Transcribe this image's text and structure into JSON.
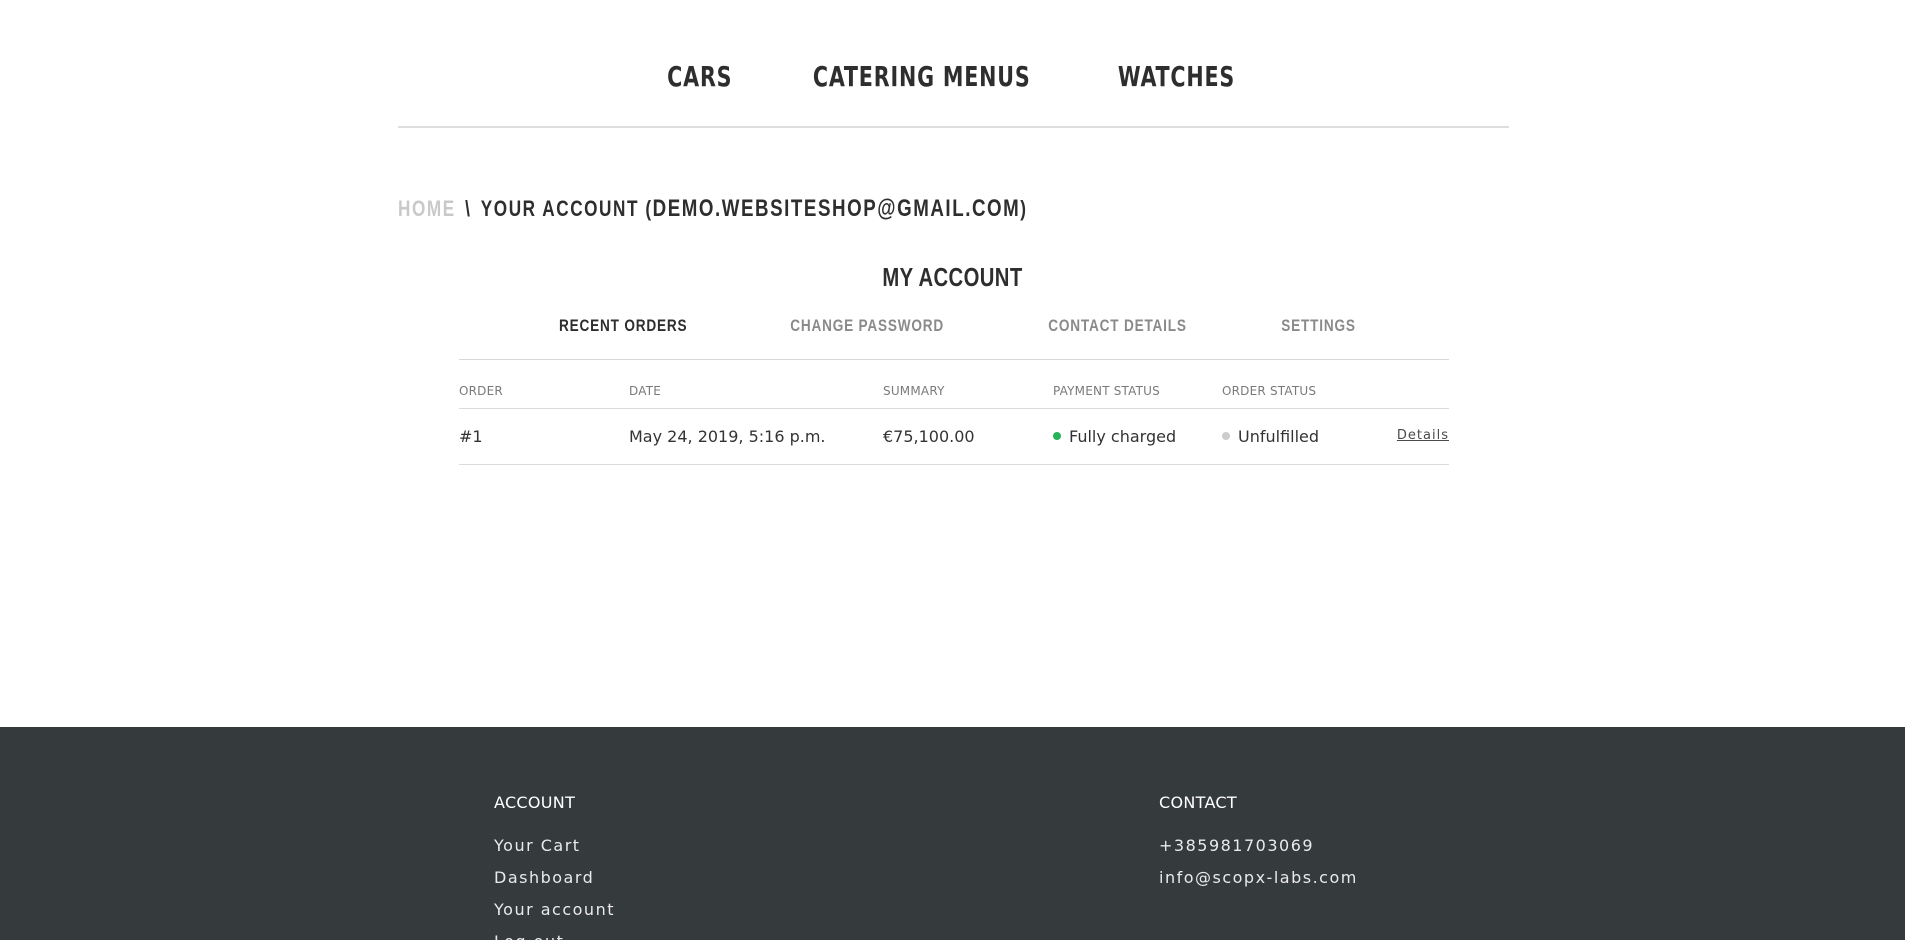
{
  "nav": {
    "items": [
      {
        "label": "Cars"
      },
      {
        "label": "Catering menus"
      },
      {
        "label": "Watches"
      }
    ]
  },
  "breadcrumb": {
    "home": "Home",
    "separator": "\\",
    "current_prefix": "Your account (",
    "email": "demo.websiteshop@gmail.com",
    "current_suffix": ")"
  },
  "account": {
    "title": "My account",
    "tabs": [
      {
        "label": "Recent orders",
        "active": true
      },
      {
        "label": "Change password",
        "active": false
      },
      {
        "label": "Contact details",
        "active": false
      },
      {
        "label": "Settings",
        "active": false
      }
    ],
    "table": {
      "headers": [
        "Order",
        "Date",
        "Summary",
        "Payment status",
        "Order status",
        ""
      ],
      "rows": [
        {
          "order": "#1",
          "date": "May 24, 2019, 5:16 p.m.",
          "summary": "€75,100.00",
          "payment_status": "Fully charged",
          "order_status": "Unfulfilled",
          "details_label": "Details"
        }
      ]
    }
  },
  "colors": {
    "payment_status_dot": "#28b35a",
    "order_status_dot": "#cccccc",
    "footer_bg": "#353a3d"
  },
  "footer": {
    "account": {
      "heading": "Account",
      "links": [
        "Your Cart",
        "Dashboard",
        "Your account",
        "Log out"
      ]
    },
    "contact": {
      "heading": "Contact",
      "phone": "+385981703069",
      "email": "info@scopx-labs.com"
    }
  }
}
